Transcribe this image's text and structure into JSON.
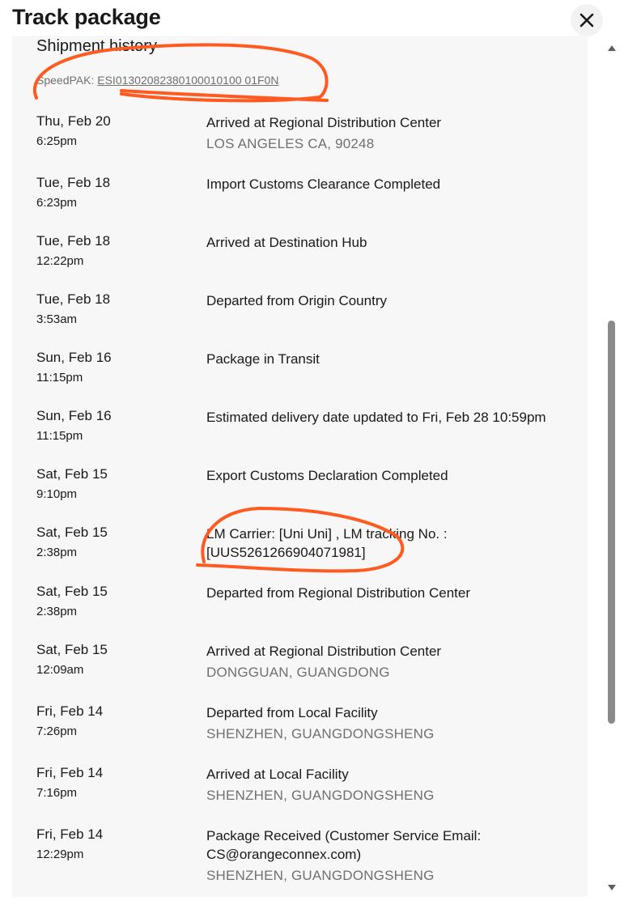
{
  "header": {
    "title": "Track package",
    "close_icon": "close-icon"
  },
  "history": {
    "heading": "Shipment history",
    "carrier_label": "SpeedPAK:",
    "tracking_number": "ESI01302082380100010100 01F0N",
    "annotation_color": "#ff5a1f"
  },
  "events": [
    {
      "date": "Thu, Feb 20",
      "time": "6:25pm",
      "event": "Arrived at Regional Distribution Center",
      "location": "LOS ANGELES CA, 90248"
    },
    {
      "date": "Tue, Feb 18",
      "time": "6:23pm",
      "event": "Import Customs Clearance Completed",
      "location": ""
    },
    {
      "date": "Tue, Feb 18",
      "time": "12:22pm",
      "event": "Arrived at Destination Hub",
      "location": ""
    },
    {
      "date": "Tue, Feb 18",
      "time": "3:53am",
      "event": "Departed from Origin Country",
      "location": ""
    },
    {
      "date": "Sun, Feb 16",
      "time": "11:15pm",
      "event": "Package in Transit",
      "location": ""
    },
    {
      "date": "Sun, Feb 16",
      "time": "11:15pm",
      "event": "Estimated delivery date updated to Fri, Feb 28 10:59pm",
      "location": ""
    },
    {
      "date": "Sat, Feb 15",
      "time": "9:10pm",
      "event": "Export Customs Declaration Completed",
      "location": ""
    },
    {
      "date": "Sat, Feb 15",
      "time": "2:38pm",
      "event": "LM Carrier: [Uni Uni] , LM tracking No. : [UUS5261266904071981]",
      "location": ""
    },
    {
      "date": "Sat, Feb 15",
      "time": "2:38pm",
      "event": "Departed from Regional Distribution Center",
      "location": ""
    },
    {
      "date": "Sat, Feb 15",
      "time": "12:09am",
      "event": "Arrived at Regional Distribution Center",
      "location": "DONGGUAN, GUANGDONG"
    },
    {
      "date": "Fri, Feb 14",
      "time": "7:26pm",
      "event": "Departed from Local Facility",
      "location": "SHENZHEN, GUANGDONGSHENG"
    },
    {
      "date": "Fri, Feb 14",
      "time": "7:16pm",
      "event": "Arrived at Local Facility",
      "location": "SHENZHEN, GUANGDONGSHENG"
    },
    {
      "date": "Fri, Feb 14",
      "time": "12:29pm",
      "event": "Package Received (Customer Service Email: CS@orangeconnex.com)",
      "location": "SHENZHEN, GUANGDONGSHENG"
    }
  ]
}
